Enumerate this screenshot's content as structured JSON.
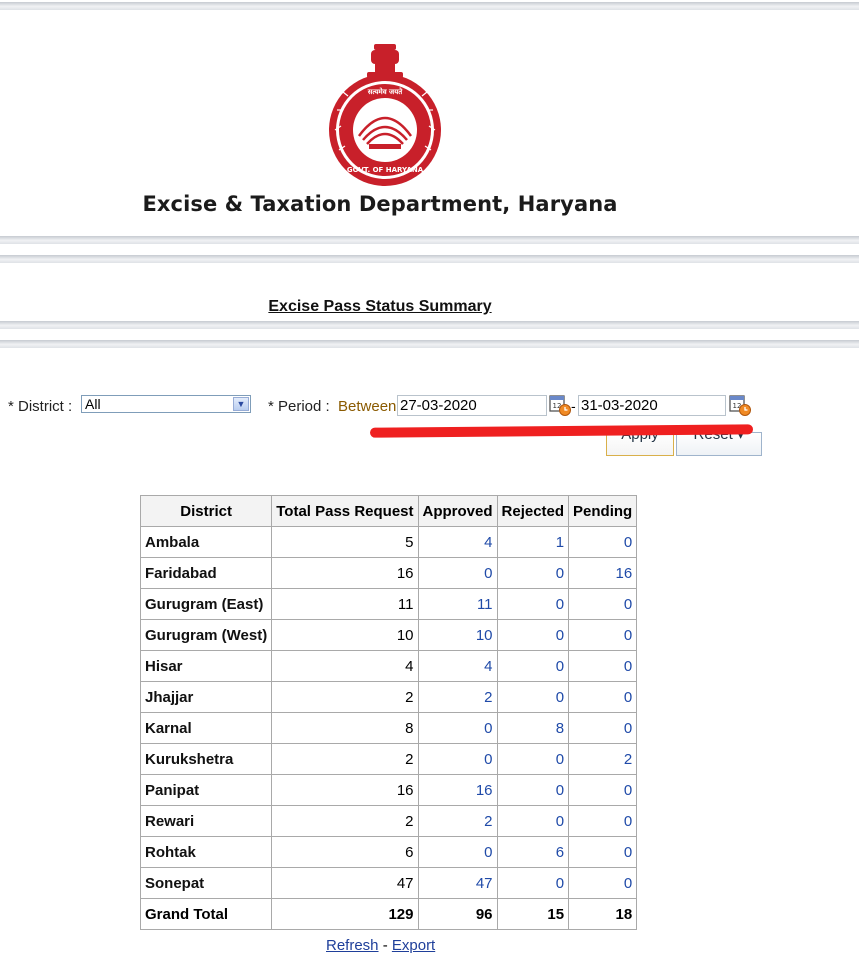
{
  "header": {
    "department_title": "Excise & Taxation Department, Haryana",
    "emblem": "haryana-government-emblem",
    "emblem_text_top": "सत्यमेव जयते",
    "emblem_text_bottom": "GOVT. OF HARYANA"
  },
  "page_title": "Excise Pass Status Summary",
  "filters": {
    "district_label": "* District :",
    "district_value": "All",
    "period_label": "* Period :",
    "between_label": "Between",
    "from_date": "27-03-2020",
    "separator": "-",
    "to_date": "31-03-2020",
    "apply_label": "Apply",
    "reset_label": "Reset ▾"
  },
  "table": {
    "headers": [
      "District",
      "Total Pass Request",
      "Approved",
      "Rejected",
      "Pending"
    ],
    "rows": [
      [
        "Ambala",
        "5",
        "4",
        "1",
        "0"
      ],
      [
        "Faridabad",
        "16",
        "0",
        "0",
        "16"
      ],
      [
        "Gurugram (East)",
        "11",
        "11",
        "0",
        "0"
      ],
      [
        "Gurugram (West)",
        "10",
        "10",
        "0",
        "0"
      ],
      [
        "Hisar",
        "4",
        "4",
        "0",
        "0"
      ],
      [
        "Jhajjar",
        "2",
        "2",
        "0",
        "0"
      ],
      [
        "Karnal",
        "8",
        "0",
        "8",
        "0"
      ],
      [
        "Kurukshetra",
        "2",
        "0",
        "0",
        "2"
      ],
      [
        "Panipat",
        "16",
        "16",
        "0",
        "0"
      ],
      [
        "Rewari",
        "2",
        "2",
        "0",
        "0"
      ],
      [
        "Rohtak",
        "6",
        "0",
        "6",
        "0"
      ],
      [
        "Sonepat",
        "47",
        "47",
        "0",
        "0"
      ]
    ],
    "total": [
      "Grand Total",
      "129",
      "96",
      "15",
      "18"
    ]
  },
  "footer": {
    "refresh_label": "Refresh",
    "separator": " - ",
    "export_label": "Export"
  },
  "colors": {
    "link": "#1f4aa8",
    "emblem_red": "#c8202a",
    "annotation_red": "#ef2020"
  },
  "icons": [
    "calendar-icon",
    "chevron-down-icon"
  ]
}
